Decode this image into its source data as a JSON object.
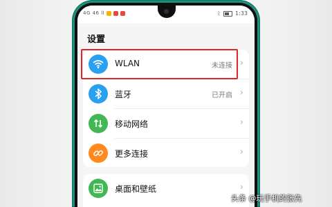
{
  "status_bar": {
    "signal_text": "4G 46 ll",
    "time": "1:33"
  },
  "page": {
    "title": "设置"
  },
  "settings_items": [
    {
      "label": "WLAN",
      "value": "未连接",
      "icon": "wifi-icon",
      "color": "#2aa0f0"
    },
    {
      "label": "蓝牙",
      "value": "已开启",
      "icon": "bluetooth-icon",
      "color": "#2aa0f0"
    },
    {
      "label": "移动网络",
      "value": "",
      "icon": "mobile-data-icon",
      "color": "#43b755"
    },
    {
      "label": "更多连接",
      "value": "",
      "icon": "link-icon",
      "color": "#ff8a1f"
    },
    {
      "label": "桌面和壁纸",
      "value": "",
      "icon": "wallpaper-icon",
      "color": "#43b755"
    }
  ],
  "watermark": {
    "text": "头条 @玩手机的张先"
  },
  "colors": {
    "phone_frame": "#1f8f7d",
    "highlight_box": "#e3242b"
  }
}
